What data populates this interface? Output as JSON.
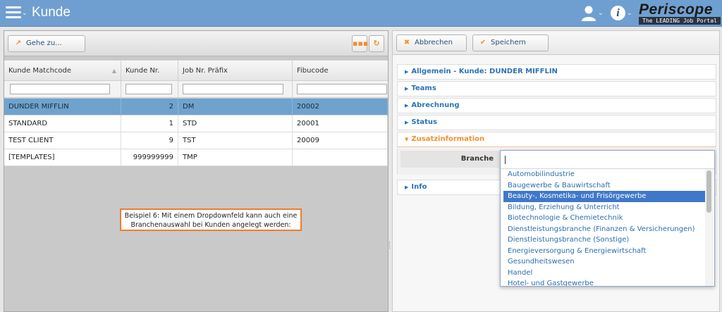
{
  "header": {
    "title": "Kunde",
    "logo_name": "Periscope",
    "logo_tagline": "The LEADING Job Portal",
    "bar_color": "#6f9fd0"
  },
  "left": {
    "goto_label": "Gehe zu...",
    "columns": [
      "Kunde Matchcode",
      "Kunde Nr.",
      "Job Nr. Präfix",
      "Fibucode"
    ],
    "rows": [
      {
        "matchcode": "DUNDER MIFFLIN",
        "nr": "2",
        "praefix": "DM",
        "fibu": "20002",
        "selected": true
      },
      {
        "matchcode": "STANDARD",
        "nr": "1",
        "praefix": "STD",
        "fibu": "20001",
        "selected": false
      },
      {
        "matchcode": "TEST CLIENT",
        "nr": "9",
        "praefix": "TST",
        "fibu": "20009",
        "selected": false
      },
      {
        "matchcode": "[TEMPLATES]",
        "nr": "999999999",
        "praefix": "TMP",
        "fibu": "",
        "selected": false
      }
    ],
    "callout": "Beispiel 6: Mit einem Dropdownfeld kann auch eine Branchenauswahl bei Kunden angelegt werden:"
  },
  "right": {
    "cancel_label": "Abbrechen",
    "save_label": "Speichern",
    "sections": [
      {
        "label": "Allgemein - Kunde: DUNDER MIFFLIN",
        "open": false
      },
      {
        "label": "Teams",
        "open": false
      },
      {
        "label": "Abrechnung",
        "open": false
      },
      {
        "label": "Status",
        "open": false
      },
      {
        "label": "Zusatzinformation",
        "open": true
      },
      {
        "label": "Info",
        "open": false
      }
    ],
    "field_label": "Branche"
  },
  "dropdown": {
    "items": [
      "Automobilindustrie",
      "Baugewerbe & Bauwirtschaft",
      "Beauty-, Kosmetika- und Frisörgewerbe",
      "Bildung, Erziehung & Unterricht",
      "Biotechnologie & Chemietechnik",
      "Dienstleistungsbranche (Finanzen & Versicherungen)",
      "Dienstleistungsbranche (Sonstige)",
      "Energieversorgung & Energiewirtschaft",
      "Gesundheitswesen",
      "Handel",
      "Hotel- und Gastgewerbe"
    ],
    "highlighted_index": 2,
    "highlight_color": "#3f78c9"
  },
  "colors": {
    "accent_orange": "#f0902f",
    "link_blue": "#2c73b5",
    "selected_row": "#6fa3cd"
  },
  "icons": {
    "menu": "hamburger-icon",
    "user": "user-icon",
    "info": "info-icon",
    "goto": "arrow-up-right-icon",
    "cancel": "x-icon",
    "save": "check-icon"
  }
}
